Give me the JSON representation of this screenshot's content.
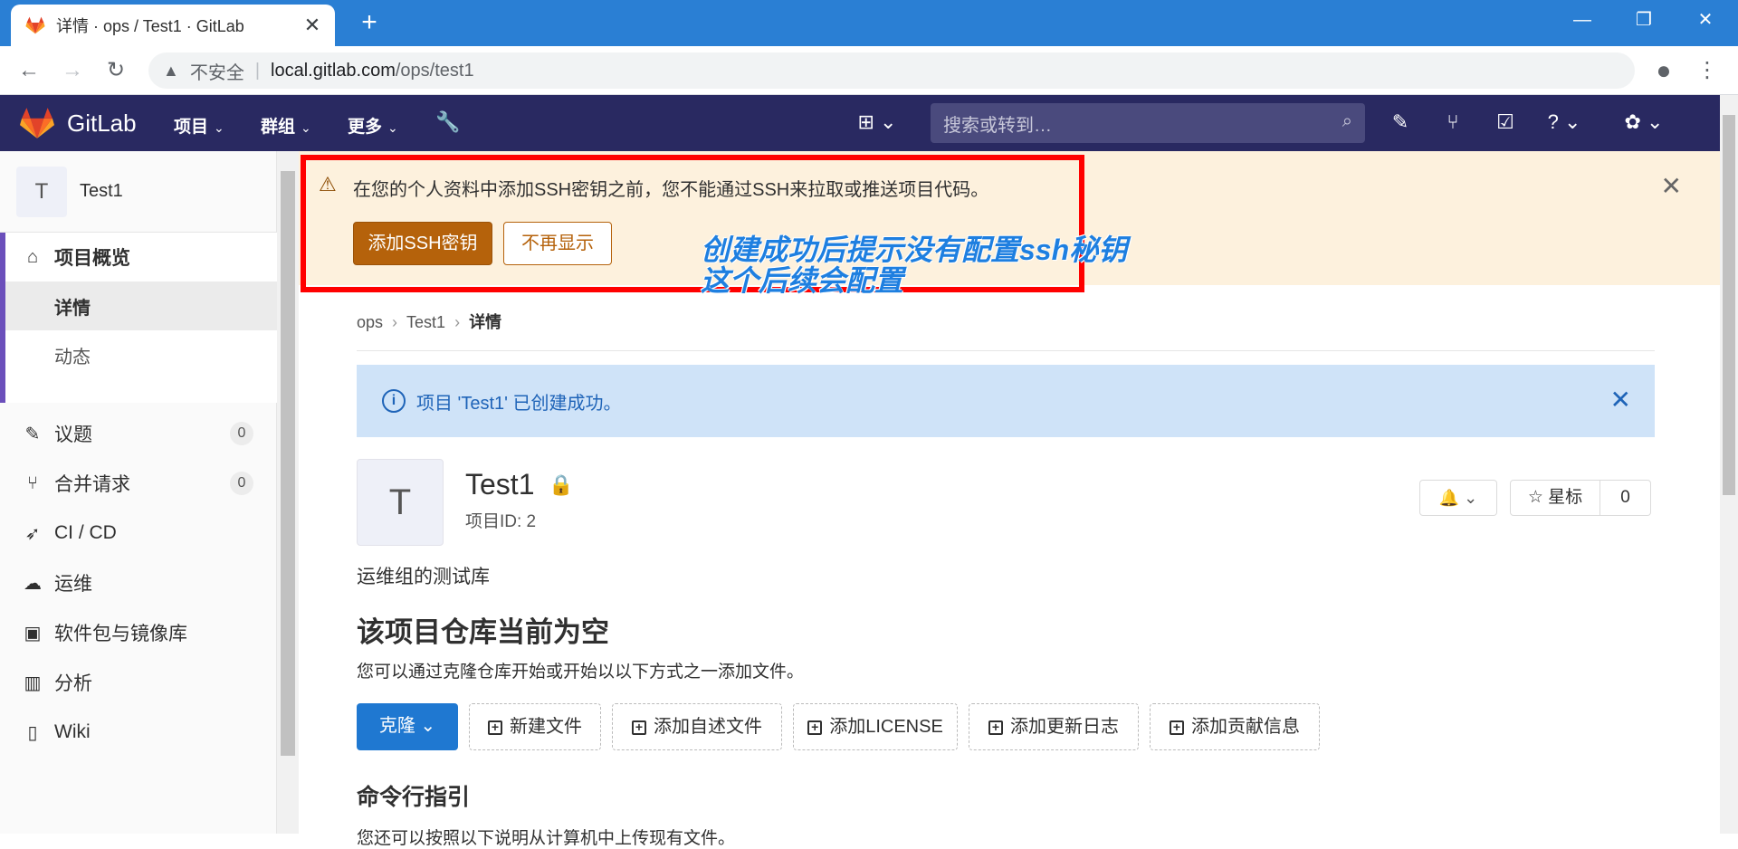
{
  "browser": {
    "tab_title": "详情 · ops / Test1 · GitLab",
    "insecure_label": "不安全",
    "url_host": "local.gitlab.com",
    "url_path": "/ops/test1"
  },
  "header": {
    "brand": "GitLab",
    "nav": [
      {
        "label": "项目"
      },
      {
        "label": "群组"
      },
      {
        "label": "更多"
      }
    ],
    "search_placeholder": "搜索或转到…"
  },
  "sidebar": {
    "project_letter": "T",
    "project_name": "Test1",
    "overview": {
      "label": "项目概览",
      "subitems": [
        {
          "label": "详情",
          "active": true
        },
        {
          "label": "动态",
          "active": false
        }
      ]
    },
    "items": [
      {
        "label": "议题",
        "icon": "issues-icon",
        "badge": "0"
      },
      {
        "label": "合并请求",
        "icon": "merge-request-icon",
        "badge": "0"
      },
      {
        "label": "CI / CD",
        "icon": "rocket-icon"
      },
      {
        "label": "运维",
        "icon": "cloud-gear-icon"
      },
      {
        "label": "软件包与镜像库",
        "icon": "package-icon"
      },
      {
        "label": "分析",
        "icon": "chart-icon"
      },
      {
        "label": "Wiki",
        "icon": "book-icon"
      }
    ]
  },
  "ssh_alert": {
    "message": "在您的个人资料中添加SSH密钥之前，您不能通过SSH来拉取或推送项目代码。",
    "add_button": "添加SSH密钥",
    "dismiss_button": "不再显示",
    "annotation_line1": "创建成功后提示没有配置ssh秘钥",
    "annotation_line2": "这个后续会配置"
  },
  "breadcrumb": [
    "ops",
    "Test1",
    "详情"
  ],
  "success_message": "项目 'Test1' 已创建成功。",
  "project": {
    "letter": "T",
    "title": "Test1",
    "id_label": "项目ID: 2",
    "star_label": "星标",
    "star_count": "0",
    "description": "运维组的测试库"
  },
  "empty_repo": {
    "title": "该项目仓库当前为空",
    "subtitle": "您可以通过克隆仓库开始或开始以以下方式之一添加文件。",
    "clone_label": "克隆",
    "add_buttons": [
      "新建文件",
      "添加自述文件",
      "添加LICENSE",
      "添加更新日志",
      "添加贡献信息"
    ]
  },
  "cli": {
    "title": "命令行指引",
    "subtitle": "您还可以按照以下说明从计算机中上传现有文件。"
  },
  "colors": {
    "header_bg": "#292961",
    "alert_bg": "#fdf1dd",
    "alert_button": "#b5620b",
    "info_bg": "#cfe3f8",
    "primary": "#1f78d1",
    "annotation": "#1e7fe0",
    "highlight_box": "#ff0000"
  }
}
